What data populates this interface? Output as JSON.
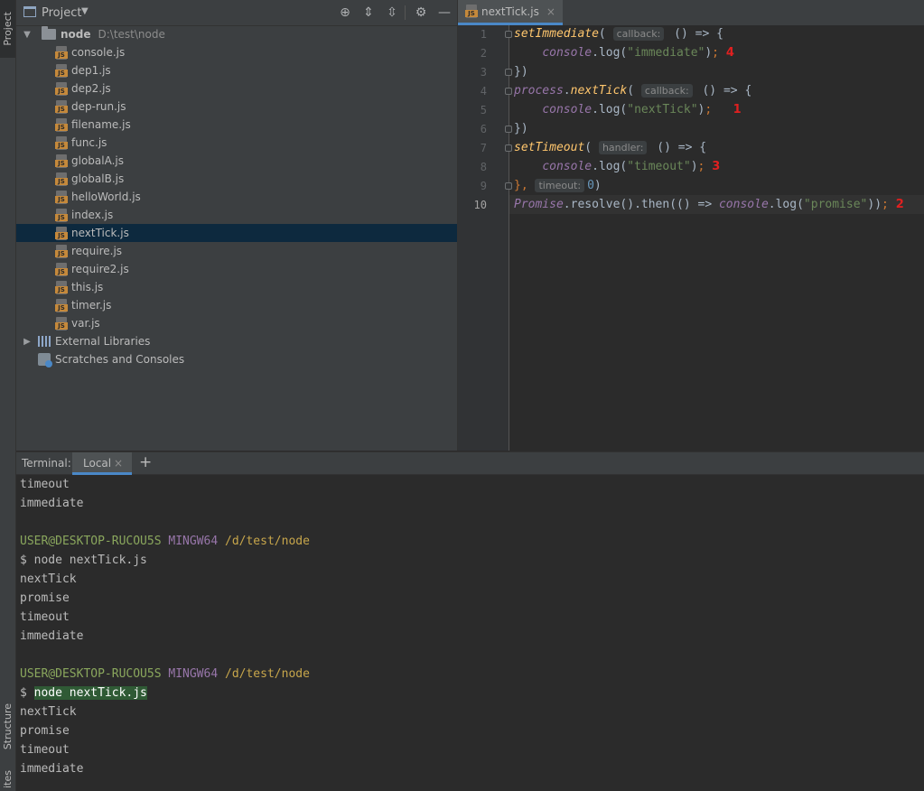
{
  "left_strip": {
    "tabs": [
      "Project",
      "Structure",
      "Favorites"
    ],
    "favorites_visible": "ites"
  },
  "project_panel": {
    "title": "Project",
    "root": {
      "name": "node",
      "path": "D:\\test\\node"
    },
    "files": [
      "console.js",
      "dep1.js",
      "dep2.js",
      "dep-run.js",
      "filename.js",
      "func.js",
      "globalA.js",
      "globalB.js",
      "helloWorld.js",
      "index.js",
      "nextTick.js",
      "require.js",
      "require2.js",
      "this.js",
      "timer.js",
      "var.js"
    ],
    "selected_file": "nextTick.js",
    "extras": [
      "External Libraries",
      "Scratches and Consoles"
    ],
    "icons": [
      "locate-icon",
      "expand-all-icon",
      "collapse-all-icon",
      "gear-icon",
      "minimize-icon"
    ]
  },
  "editor": {
    "tab": {
      "name": "nextTick.js",
      "close": "×"
    },
    "line_numbers": [
      "1",
      "2",
      "3",
      "4",
      "5",
      "6",
      "7",
      "8",
      "9",
      "10"
    ],
    "code": {
      "l1_fn": "setImmediate",
      "l1_paren": "(",
      "l1_hint": "callback:",
      "l1_rest": " () => {",
      "l2_indent": "    ",
      "l2_obj": "console",
      "l2_dot": ".",
      "l2_method": "log(",
      "l2_str": "\"immediate\"",
      "l2_close": ")",
      "l2_semi": ";",
      "l2_annot": "4",
      "l3": "})",
      "l4_fn": "process",
      "l4_dot": ".",
      "l4_method": "nextTick",
      "l4_paren": "(",
      "l4_hint": "callback:",
      "l4_rest": " () => {",
      "l5_indent": "    ",
      "l5_obj": "console",
      "l5_dot": ".",
      "l5_method": "log(",
      "l5_str": "\"nextTick\"",
      "l5_close": ")",
      "l5_semi": ";",
      "l5_annot": "1",
      "l6": "})",
      "l7_fn": "setTimeout",
      "l7_paren": "(",
      "l7_hint": "handler:",
      "l7_rest": " () => {",
      "l8_indent": "    ",
      "l8_obj": "console",
      "l8_dot": ".",
      "l8_method": "log(",
      "l8_str": "\"timeout\"",
      "l8_close": ")",
      "l8_semi": ";",
      "l8_annot": "3",
      "l9_start": "}, ",
      "l9_hint": "timeout:",
      "l9_num": "0",
      "l9_close": ")",
      "l10_obj": "Promise",
      "l10_mid": ".resolve().then(() => ",
      "l10_obj2": "console",
      "l10_log": ".log(",
      "l10_str": "\"promise\"",
      "l10_close": "))",
      "l10_semi": ";",
      "l10_annot": "2"
    }
  },
  "terminal": {
    "label": "Terminal:",
    "tab": "Local",
    "tab_close": "×",
    "add": "+",
    "output_top": [
      "timeout",
      "immediate"
    ],
    "prompt1": {
      "user": "USER@DESKTOP-RUCOU5S",
      "sys": "MINGW64",
      "path": "/d/test/node"
    },
    "cmd1": "$ node nextTick.js",
    "output1": [
      "nextTick",
      "promise",
      "timeout",
      "immediate"
    ],
    "prompt2": {
      "user": "USER@DESKTOP-RUCOU5S",
      "sys": "MINGW64",
      "path": "/d/test/node"
    },
    "cmd2_dollar": "$ ",
    "cmd2": "node nextTick.js",
    "output2": [
      "nextTick",
      "promise",
      "timeout",
      "immediate"
    ]
  }
}
